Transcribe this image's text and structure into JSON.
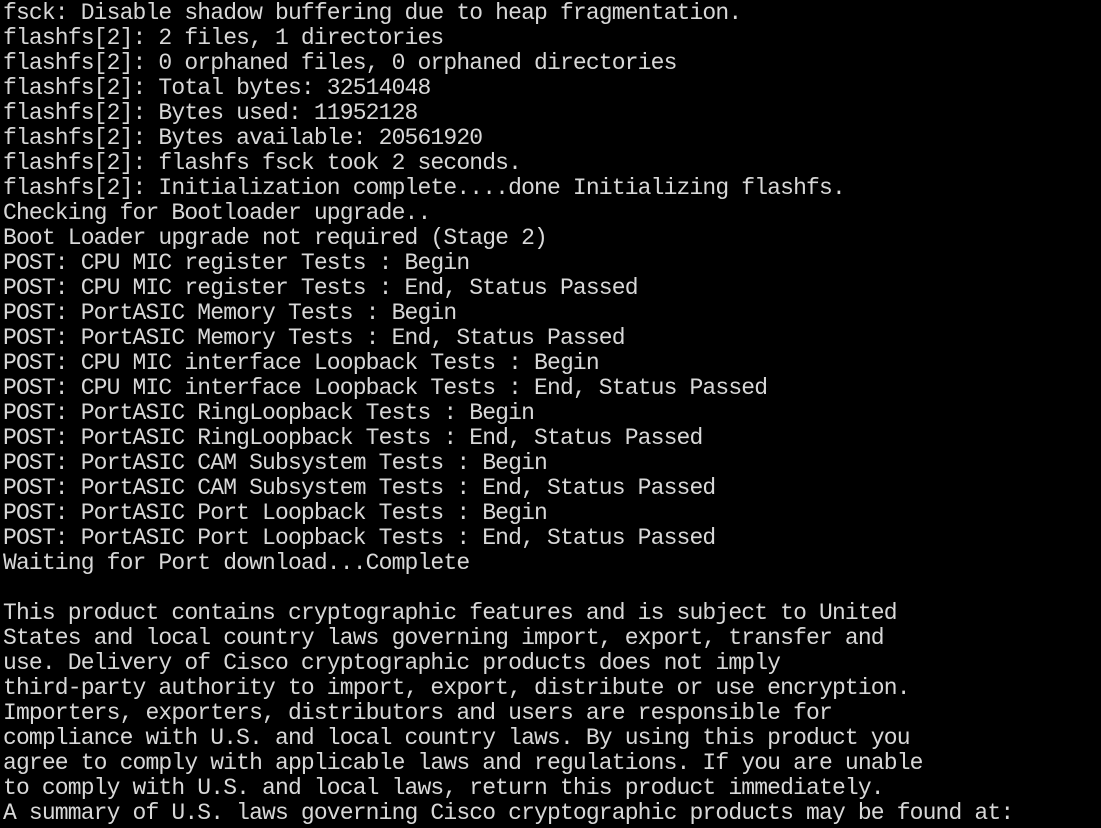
{
  "colors": {
    "background": "#000000",
    "text": "#d8d8d8"
  },
  "terminal": {
    "lines": [
      "fsck: Disable shadow buffering due to heap fragmentation.",
      "flashfs[2]: 2 files, 1 directories",
      "flashfs[2]: 0 orphaned files, 0 orphaned directories",
      "flashfs[2]: Total bytes: 32514048",
      "flashfs[2]: Bytes used: 11952128",
      "flashfs[2]: Bytes available: 20561920",
      "flashfs[2]: flashfs fsck took 2 seconds.",
      "flashfs[2]: Initialization complete....done Initializing flashfs.",
      "Checking for Bootloader upgrade..",
      "Boot Loader upgrade not required (Stage 2)",
      "POST: CPU MIC register Tests : Begin",
      "POST: CPU MIC register Tests : End, Status Passed",
      "POST: PortASIC Memory Tests : Begin",
      "POST: PortASIC Memory Tests : End, Status Passed",
      "POST: CPU MIC interface Loopback Tests : Begin",
      "POST: CPU MIC interface Loopback Tests : End, Status Passed",
      "POST: PortASIC RingLoopback Tests : Begin",
      "POST: PortASIC RingLoopback Tests : End, Status Passed",
      "POST: PortASIC CAM Subsystem Tests : Begin",
      "POST: PortASIC CAM Subsystem Tests : End, Status Passed",
      "POST: PortASIC Port Loopback Tests : Begin",
      "POST: PortASIC Port Loopback Tests : End, Status Passed",
      "Waiting for Port download...Complete",
      "",
      "This product contains cryptographic features and is subject to United",
      "States and local country laws governing import, export, transfer and",
      "use. Delivery of Cisco cryptographic products does not imply",
      "third-party authority to import, export, distribute or use encryption.",
      "Importers, exporters, distributors and users are responsible for",
      "compliance with U.S. and local country laws. By using this product you",
      "agree to comply with applicable laws and regulations. If you are unable",
      "to comply with U.S. and local laws, return this product immediately.",
      "A summary of U.S. laws governing Cisco cryptographic products may be found at:"
    ]
  }
}
